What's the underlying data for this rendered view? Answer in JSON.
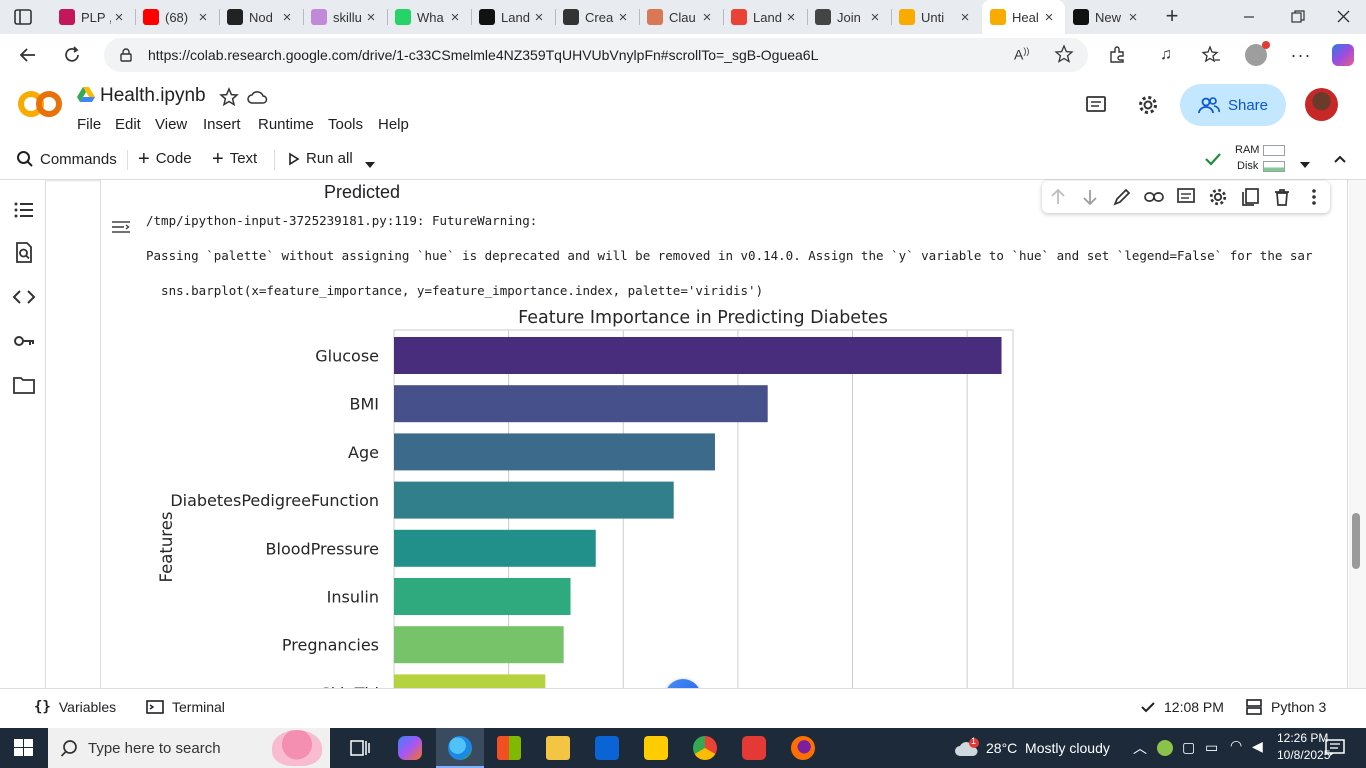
{
  "browser": {
    "tabs": [
      {
        "title": "PLP ,",
        "color": "#c2185b"
      },
      {
        "title": "(68)",
        "color": "#ff0000"
      },
      {
        "title": "Nod",
        "color": "#222222"
      },
      {
        "title": "skillu",
        "color": "#c08ad9"
      },
      {
        "title": "Wha",
        "color": "#25d366"
      },
      {
        "title": "Land",
        "color": "#111111"
      },
      {
        "title": "Crea",
        "color": "#333333"
      },
      {
        "title": "Clau",
        "color": "#d97757"
      },
      {
        "title": "Land",
        "color": "#ea4335"
      },
      {
        "title": "Join",
        "color": "#444444"
      },
      {
        "title": "Unti",
        "color": "#f9ab00"
      },
      {
        "title": "Heal",
        "color": "#f9ab00"
      },
      {
        "title": "New",
        "color": "#111111"
      }
    ],
    "active_tab_index": 11,
    "url": "https://colab.research.google.com/drive/1-c33CSmelmle4NZ359TqUHVUbVnylpFn#scrollTo=_sgB-Oguea6L"
  },
  "colab": {
    "notebook_title": "Health.ipynb",
    "menu": [
      "File",
      "Edit",
      "View",
      "Insert",
      "Runtime",
      "Tools",
      "Help"
    ],
    "share_label": "Share",
    "toolbar": {
      "commands": "Commands",
      "code": "Code",
      "text": "Text",
      "run_all": "Run all",
      "ram": "RAM",
      "disk": "Disk"
    }
  },
  "cell": {
    "prev_xlabel": "Predicted",
    "warning_line1": "/tmp/ipython-input-3725239181.py:119: FutureWarning:",
    "warning_line2": "Passing `palette` without assigning `hue` is deprecated and will be removed in v0.14.0. Assign the `y` variable to `hue` and set `legend=False` for the sar",
    "warning_line3": "  sns.barplot(x=feature_importance, y=feature_importance.index, palette='viridis')"
  },
  "chart_data": {
    "type": "bar",
    "orientation": "horizontal",
    "title": "Feature Importance in Predicting Diabetes",
    "ylabel": "Features",
    "xlabel": "",
    "categories": [
      "Glucose",
      "BMI",
      "Age",
      "DiabetesPedigreeFunction",
      "BloodPressure",
      "Insulin",
      "Pregnancies",
      "SkinThickness"
    ],
    "visible_category_labels": [
      "Glucose",
      "BMI",
      "Age",
      "DiabetesPedigreeFunction",
      "BloodPressure",
      "Insulin",
      "Pregnancies",
      "SkinThi"
    ],
    "values": [
      0.265,
      0.163,
      0.14,
      0.122,
      0.088,
      0.077,
      0.074,
      0.066
    ],
    "xlim": [
      0,
      0.27
    ],
    "grid": true,
    "colors": [
      "#472d7b",
      "#46508a",
      "#3b6a8b",
      "#307f8b",
      "#22908a",
      "#2faa7e",
      "#76c36a",
      "#b5d23f"
    ]
  },
  "statusbar": {
    "variables": "Variables",
    "terminal": "Terminal",
    "exec_time": "12:08 PM",
    "kernel": "Python 3"
  },
  "taskbar": {
    "search_placeholder": "Type here to search",
    "weather": "28°C  Mostly cloudy",
    "time": "12:26 PM",
    "date": "10/8/2025",
    "notification_count": "1"
  },
  "colors": {
    "share_bg": "#c2e7ff",
    "accent": "#0b57d0",
    "colab_orange": "#f9ab00",
    "taskbar_bg": "#1d2a3a"
  }
}
